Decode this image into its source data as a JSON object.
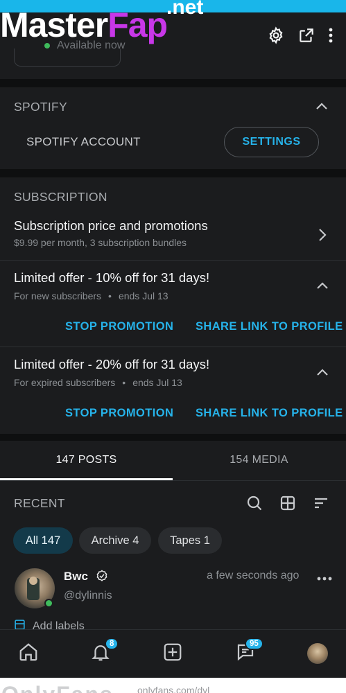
{
  "watermark": {
    "part1": "Master",
    "part2": "Fap",
    "suffix": ".net"
  },
  "header": {
    "status_text": "Available now",
    "icons": [
      "gear-icon",
      "share-icon",
      "more-vertical-icon"
    ]
  },
  "spotify": {
    "title": "SPOTIFY",
    "account_label": "SPOTIFY ACCOUNT",
    "settings_label": "SETTINGS"
  },
  "subscription": {
    "title": "SUBSCRIPTION",
    "price_title": "Subscription price and promotions",
    "price_sub": "$9.99 per month, 3 subscription bundles",
    "offers": [
      {
        "title": "Limited offer - 10% off for 31 days!",
        "audience": "For new subscribers",
        "ends": "ends Jul 13",
        "stop_label": "STOP PROMOTION",
        "share_label": "SHARE LINK TO PROFILE"
      },
      {
        "title": "Limited offer - 20% off for 31 days!",
        "audience": "For expired subscribers",
        "ends": "ends Jul 13",
        "stop_label": "STOP PROMOTION",
        "share_label": "SHARE LINK TO PROFILE"
      }
    ]
  },
  "tabs": [
    {
      "label": "147 POSTS",
      "active": true
    },
    {
      "label": "154 MEDIA",
      "active": false
    }
  ],
  "recent": {
    "title": "RECENT",
    "icons": [
      "search-icon",
      "grid-icon",
      "sort-icon"
    ]
  },
  "filters": [
    {
      "label": "All 147",
      "active": true
    },
    {
      "label": "Archive 4",
      "active": false
    },
    {
      "label": "Tapes 1",
      "active": false
    }
  ],
  "post": {
    "name": "Bwc",
    "handle": "@dylinnis",
    "time": "a few seconds ago",
    "add_labels": "Add labels"
  },
  "bottom_nav": {
    "items": [
      "home-icon",
      "bell-icon",
      "plus-square-icon",
      "messages-icon",
      "profile-avatar"
    ],
    "notifications_count": "8",
    "messages_count": "95"
  },
  "footer_watermark": {
    "big": "OnlyFans",
    "small": "onlyfans.com/dyl"
  },
  "colors": {
    "accent": "#26b3ea",
    "background": "#1b1c1e",
    "online": "#3fbb5c"
  }
}
